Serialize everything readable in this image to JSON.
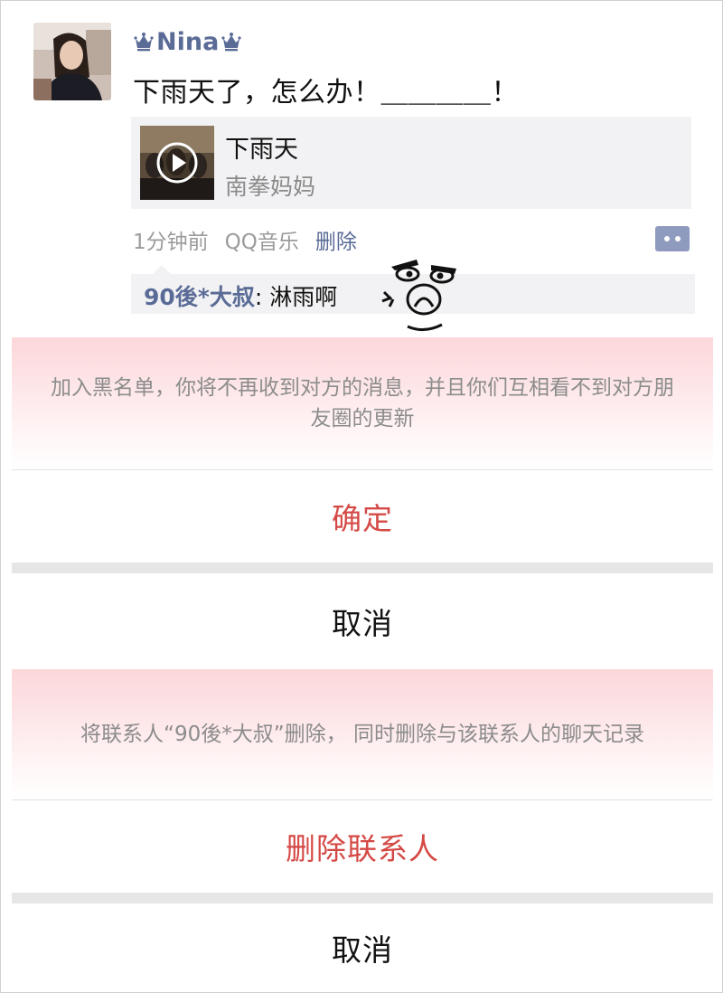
{
  "post": {
    "username": "Nina",
    "text": "下雨天了，怎么办！＿＿＿＿！",
    "music": {
      "title": "下雨天",
      "artist": "南拳妈妈"
    },
    "meta": {
      "time": "1分钟前",
      "source": "QQ音乐",
      "delete_label": "删除"
    },
    "comment": {
      "user": "90後*大叔",
      "separator": ": ",
      "text": "淋雨啊"
    },
    "icons": {
      "crown": "crown-icon",
      "play": "play-icon",
      "comment": "comment-icon"
    }
  },
  "sheets": [
    {
      "message": "加入黑名单，你将不再收到对方的消息，并且你们互相看不到对方朋友圈的更新",
      "confirm_label": "确定",
      "cancel_label": "取消"
    },
    {
      "message": "将联系人“90後*大叔”删除， 同时删除与该联系人的聊天记录",
      "confirm_label": "删除联系人",
      "cancel_label": "取消"
    }
  ],
  "colors": {
    "name_link": "#5a6b96",
    "danger": "#d44945",
    "sheet_tint": "#fcd7da",
    "separator": "#e6e6e6"
  }
}
